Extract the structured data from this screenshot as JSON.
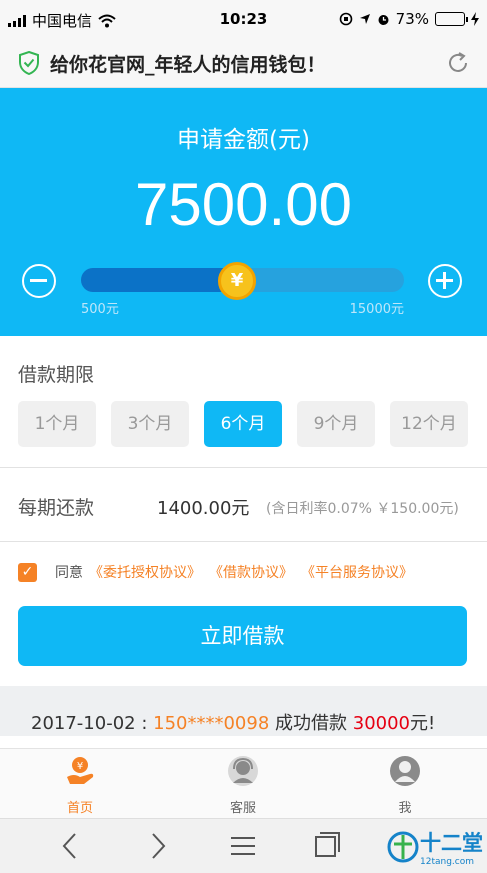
{
  "status_bar": {
    "carrier": "中国电信",
    "time": "10:23",
    "battery": "73%",
    "battery_level": 0.73
  },
  "title_bar": {
    "title": "给你花官网_年轻人的信用钱包！"
  },
  "loan": {
    "label": "申请金额(元)",
    "amount": "7500.00",
    "min_label": "500元",
    "max_label": "15000元",
    "slider_fraction": 0.483,
    "thumb_symbol": "¥"
  },
  "term": {
    "heading": "借款期限",
    "options": [
      "1个月",
      "3个月",
      "6个月",
      "9个月",
      "12个月"
    ],
    "selected_index": 2
  },
  "repayment": {
    "label": "每期还款",
    "value": "1400.00元",
    "note": "(含日利率0.07% ￥150.00元)"
  },
  "agreement": {
    "checked": true,
    "prefix": "同意",
    "links": [
      "《委托授权协议》",
      "《借款协议》",
      "《平台服务协议》"
    ]
  },
  "submit_label": "立即借款",
  "ticker": {
    "date": "2017-10-02 : ",
    "phone": "150****0098",
    "action": " 成功借款 ",
    "amount": "30000",
    "suffix": "元!"
  },
  "tabbar": {
    "items": [
      {
        "label": "首页",
        "icon": "hand-yuan-icon",
        "active": true
      },
      {
        "label": "客服",
        "icon": "customer-service-icon",
        "active": false
      },
      {
        "label": "我",
        "icon": "user-icon",
        "active": false
      }
    ]
  },
  "watermark": {
    "text": "十二堂",
    "sub": "12tang.com"
  },
  "colors": {
    "primary": "#0fb8f5",
    "accent": "#f58226",
    "highlight": "#e60012"
  }
}
